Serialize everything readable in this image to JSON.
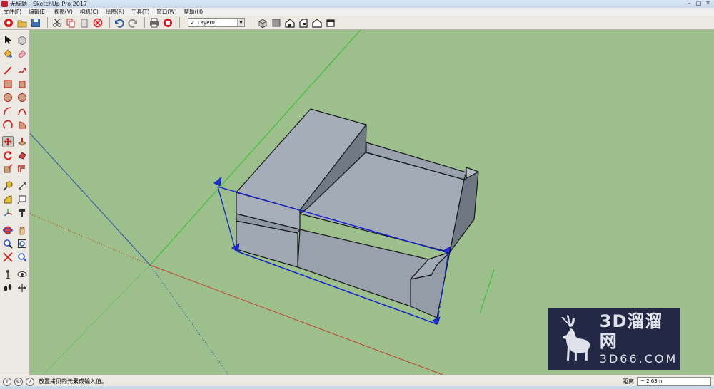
{
  "window": {
    "title": "无标题 - SketchUp Pro 2017",
    "app_icon": "sketchup-logo-icon",
    "controls": [
      "minimize-icon",
      "maximize-icon",
      "close-icon"
    ]
  },
  "menubar": {
    "items": [
      "文件(F)",
      "编辑(E)",
      "视图(V)",
      "相机(C)",
      "绘图(R)",
      "工具(T)",
      "窗口(W)",
      "帮助(H)"
    ]
  },
  "toolbar": {
    "icons": [
      "getting-started-icon",
      "open-icon",
      "save-icon",
      "cut-icon",
      "copy-icon",
      "paste-icon",
      "erase-icon",
      "undo-icon",
      "redo-icon",
      "print-icon",
      "model-info-icon"
    ],
    "layer": {
      "checked": "✓",
      "value": "Layer0"
    },
    "view_icons": [
      "iso-view-icon",
      "top-view-icon",
      "front-view-icon",
      "right-view-icon",
      "back-view-icon",
      "left-view-icon"
    ]
  },
  "palette": {
    "rows": [
      [
        "select-icon",
        "make-component-icon"
      ],
      [
        "paint-bucket-icon",
        "eraser-icon"
      ],
      [
        "line-icon",
        "freehand-icon"
      ],
      [
        "rectangle-icon",
        "rotated-rectangle-icon"
      ],
      [
        "circle-icon",
        "polygon-icon"
      ],
      [
        "arc-icon",
        "two-point-arc-icon"
      ],
      [
        "three-point-arc-icon",
        "pie-icon"
      ],
      [
        "move-icon",
        "push-pull-icon"
      ],
      [
        "rotate-icon",
        "follow-me-icon"
      ],
      [
        "scale-icon",
        "offset-icon"
      ],
      [
        "tape-measure-icon",
        "dimension-icon"
      ],
      [
        "protractor-icon",
        "text-icon"
      ],
      [
        "axes-icon",
        "3d-text-icon"
      ],
      [
        "orbit-icon",
        "pan-icon"
      ],
      [
        "zoom-icon",
        "zoom-window-icon"
      ],
      [
        "zoom-extents-icon",
        "previous-view-icon"
      ],
      [
        "position-camera-icon",
        "look-around-icon"
      ],
      [
        "walk-icon",
        "section-plane-icon"
      ]
    ]
  },
  "watermark": {
    "text_cn": "3D溜溜网",
    "text_en": "3D66.COM",
    "logo": "deer-logo-icon"
  },
  "statusbar": {
    "message": "放置拷贝的元素或输入值。",
    "measure_label": "距离",
    "measure_value": "~ 2.63m",
    "icons": [
      "geo-location-icon",
      "credits-icon",
      "help-icon"
    ]
  },
  "colors": {
    "viewport_bg": "#9cbf8b",
    "model_face_top": "#a1aab4",
    "model_face_side": "#8d97a2",
    "selection_blue": "#1020d0",
    "axis_red": "#c24030",
    "axis_green": "#2fbf30",
    "axis_blue": "#3050b0"
  }
}
